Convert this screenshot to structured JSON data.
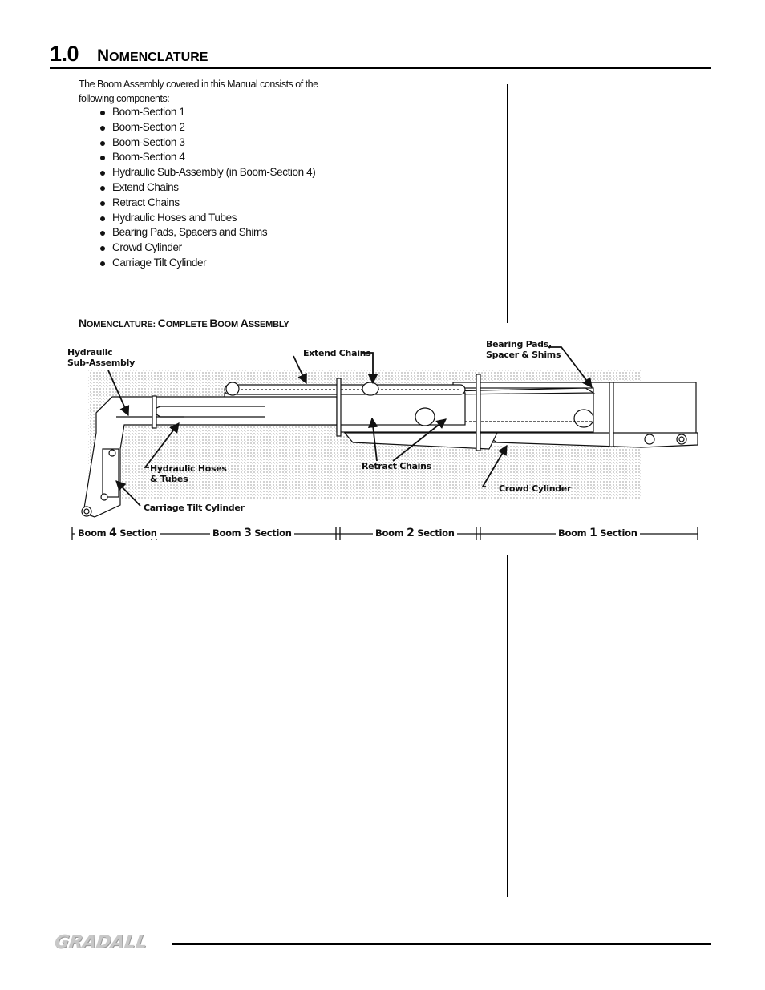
{
  "header": {
    "section_number": "1.0",
    "title_initial": "N",
    "title_rest": "OMENCLATURE"
  },
  "intro": {
    "text": "The Boom Assembly covered in this Manual consists of the following components:"
  },
  "components": [
    "Boom-Section 1",
    "Boom-Section 2",
    "Boom-Section 3",
    "Boom-Section 4",
    "Hydraulic Sub-Assembly (in Boom-Section 4)",
    "Extend Chains",
    "Retract Chains",
    "Hydraulic Hoses and Tubes",
    "Bearing Pads, Spacers and Shims",
    "Crowd Cylinder",
    "Carriage Tilt Cylinder"
  ],
  "figure": {
    "title_parts": [
      {
        "cap": "N",
        "rest": "OMENCLATURE: "
      },
      {
        "cap": "C",
        "rest": "OMPLETE "
      },
      {
        "cap": "B",
        "rest": "OOM "
      },
      {
        "cap": "A",
        "rest": "SSEMBLY"
      }
    ],
    "callouts": {
      "hydraulic_sub_assembly_1": "Hydraulic",
      "hydraulic_sub_assembly_2": "Sub-Assembly",
      "extend_chains": "Extend Chains",
      "bearing_pads_1": "Bearing Pads,",
      "bearing_pads_2": "Spacer & Shims",
      "hydraulic_hoses_1": "Hydraulic Hoses",
      "hydraulic_hoses_2": "& Tubes",
      "retract_chains": "Retract Chains",
      "crowd_cylinder": "Crowd Cylinder",
      "carriage_tilt_cylinder": "Carriage Tilt Cylinder"
    },
    "sections": [
      {
        "prefix": "Boom",
        "number": "4",
        "suffix": "Section"
      },
      {
        "prefix": "Boom",
        "number": "3",
        "suffix": "Section"
      },
      {
        "prefix": "Boom",
        "number": "2",
        "suffix": "Section"
      },
      {
        "prefix": "Boom",
        "number": "1",
        "suffix": "Section"
      }
    ]
  },
  "footer": {
    "brand": "GRADALL",
    "brand_color": "#c8c8c8"
  }
}
